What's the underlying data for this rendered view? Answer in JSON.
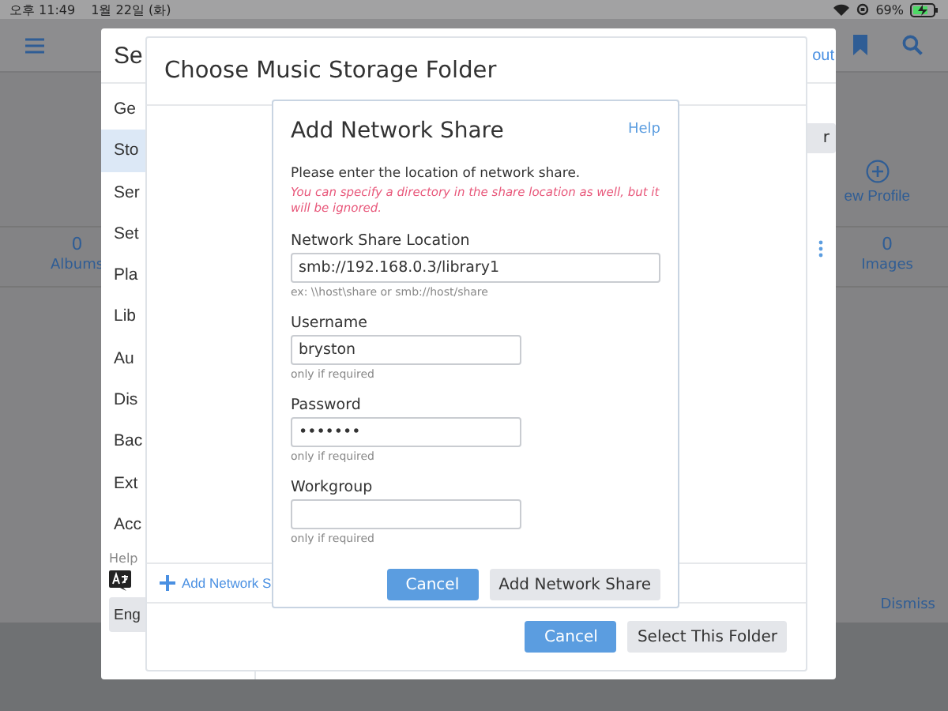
{
  "status_bar": {
    "time": "오후 11:49",
    "date": "1월 22일 (화)",
    "battery": "69%"
  },
  "background": {
    "new_profile": "ew Profile",
    "stats": [
      {
        "count": "0",
        "label": "Albums"
      },
      {
        "count": "0",
        "label": "Images"
      }
    ],
    "dismiss": "Dismiss"
  },
  "settings_dialog": {
    "title": "Se",
    "logout": "out",
    "header_button": "r",
    "nav": [
      {
        "label": "Ge",
        "selected": false
      },
      {
        "label": "Sto",
        "selected": true
      },
      {
        "label": "Ser",
        "selected": false
      },
      {
        "label": "Set",
        "selected": false
      },
      {
        "label": "Pla",
        "selected": false
      },
      {
        "label": "Lib",
        "selected": false
      },
      {
        "label": "Au",
        "selected": false
      },
      {
        "label": "Dis",
        "selected": false
      },
      {
        "label": "Bac",
        "selected": false
      },
      {
        "label": "Ext",
        "selected": false
      },
      {
        "label": "Acc",
        "selected": false
      }
    ],
    "help": "Help",
    "language_button": "Eng"
  },
  "folder_dialog": {
    "title": "Choose Music Storage Folder",
    "add_share": "Add Network S",
    "buttons": [
      {
        "label": "Cancel",
        "kind": "primary"
      },
      {
        "label": "Select This Folder",
        "kind": "secondary"
      }
    ]
  },
  "share_dialog": {
    "title": "Add Network Share",
    "help": "Help",
    "intro": "Please enter the location of network share.",
    "warning": "You can specify a directory in the share location as well, but it will be ignored.",
    "fields": [
      {
        "label": "Network Share Location",
        "value": "smb://192.168.0.3/library1",
        "hint": "ex: \\\\host\\share or smb://host/share"
      },
      {
        "label": "Username",
        "value": "bryston",
        "hint": "only if required"
      },
      {
        "label": "Password",
        "value": "•••••••",
        "hint": "only if required"
      },
      {
        "label": "Workgroup",
        "hint": "only if required"
      }
    ],
    "buttons": [
      {
        "label": "Cancel",
        "kind": "primary"
      },
      {
        "label": "Add Network Share",
        "kind": "secondary"
      }
    ]
  }
}
